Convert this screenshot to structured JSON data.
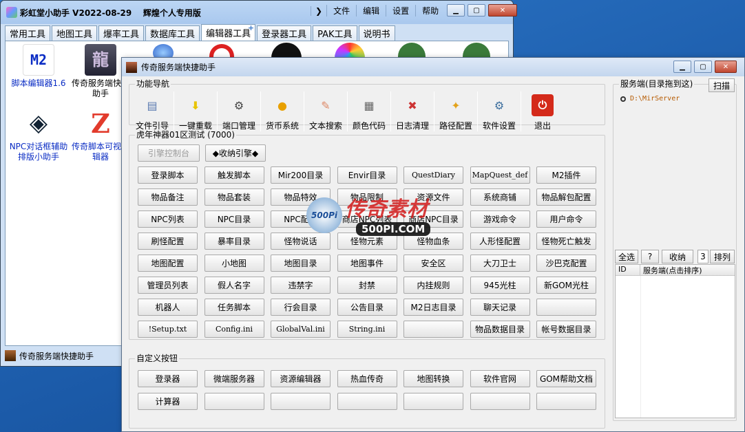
{
  "back_window": {
    "title": "彩虹堂小助手 V2022-08-29    辉煌个人专用版",
    "menu": [
      "文件",
      "编辑",
      "设置",
      "帮助"
    ],
    "tabs": [
      "常用工具",
      "地图工具",
      "爆率工具",
      "数据库工具",
      "编辑器工具",
      "登录器工具",
      "PAK工具",
      "说明书"
    ],
    "active_tab": "编辑器工具",
    "tab_add_glyph": "+",
    "desktop_items": [
      {
        "label": "脚本编辑器1.6",
        "icon": "m2-edit-icon",
        "icon_text": "M2"
      },
      {
        "label": "传奇服务端快捷助手",
        "icon": "dragon-icon",
        "icon_text": "龍"
      },
      {
        "label": "NPC对话框辅助排版小助手",
        "icon": "npc-dialog-icon",
        "icon_text": "◈"
      },
      {
        "label": "传奇脚本可视编辑器",
        "icon": "z-editor-icon",
        "icon_text": "Z"
      }
    ],
    "status_text": "传奇服务端快捷助手"
  },
  "front_window": {
    "title": "传奇服务端快捷助手",
    "nav_group": "功能导航",
    "toolbar": [
      {
        "label": "文件引导",
        "icon": "file-guide-icon",
        "glyph": "▤"
      },
      {
        "label": "一键重载",
        "icon": "reload-icon",
        "glyph": "⬇"
      },
      {
        "label": "端口管理",
        "icon": "port-icon",
        "glyph": "⚙"
      },
      {
        "label": "货币系统",
        "icon": "coin-icon",
        "glyph": "●"
      },
      {
        "label": "文本搜索",
        "icon": "text-search-icon",
        "glyph": "✎"
      },
      {
        "label": "颜色代码",
        "icon": "color-code-icon",
        "glyph": "▦"
      },
      {
        "label": "日志清理",
        "icon": "log-clean-icon",
        "glyph": "✖"
      },
      {
        "label": "路径配置",
        "icon": "path-config-icon",
        "glyph": "✦"
      },
      {
        "label": "软件设置",
        "icon": "settings-gear-icon",
        "glyph": "⚙"
      },
      {
        "label": "退出",
        "icon": "power-icon",
        "glyph": "⏻"
      }
    ],
    "server_group": "虎年神器01区测试 (7000)",
    "server_buttons": [
      "引擎控制台",
      "◆收纳引擎◆"
    ],
    "grid": [
      [
        "登录脚本",
        "触发脚本",
        "Mir200目录",
        "Envir目录",
        "QuestDiary",
        "MapQuest_def",
        "M2插件"
      ],
      [
        "物品备注",
        "物品套装",
        "物品特效",
        "物品限制",
        "资源文件",
        "系统商铺",
        "物品解包配置"
      ],
      [
        "NPC列表",
        "NPC目录",
        "NPC配置",
        "商店NPC列表",
        "商店NPC目录",
        "游戏命令",
        "用户命令"
      ],
      [
        "刷怪配置",
        "暴率目录",
        "怪物说话",
        "怪物元素",
        "怪物血条",
        "人形怪配置",
        "怪物死亡触发"
      ],
      [
        "地图配置",
        "小地图",
        "地图目录",
        "地图事件",
        "安全区",
        "大刀卫士",
        "沙巴克配置"
      ],
      [
        "管理员列表",
        "假人名字",
        "违禁字",
        "封禁",
        "内挂规则",
        "945光柱",
        "新GOM光柱"
      ],
      [
        "机器人",
        "任务脚本",
        "行会目录",
        "公告目录",
        "M2日志目录",
        "聊天记录",
        ""
      ],
      [
        "!Setup.txt",
        "Config.ini",
        "GlobalVal.ini",
        "String.ini",
        "",
        "物品数据目录",
        "帐号数据目录"
      ]
    ],
    "custom_group": "自定义按钮",
    "custom_buttons": [
      [
        "登录器",
        "微端服务器",
        "资源编辑器",
        "热血传奇",
        "地图转换",
        "软件官网",
        "GOM帮助文档"
      ],
      [
        "计算器",
        "",
        "",
        "",
        "",
        "",
        ""
      ]
    ],
    "right_group": "服务端(目录拖到这)",
    "scan_button": "扫描",
    "server_path": "D:\\MirServer",
    "list_buttons": {
      "select_all": "全选",
      "help": "?",
      "collapse": "收纳",
      "count": "3",
      "sort": "排列"
    },
    "list_headers": [
      "ID",
      "服务端(点击排序)"
    ]
  },
  "watermark": {
    "text": "传奇素材",
    "site": "500PI.COM",
    "badge": "500Pi"
  }
}
